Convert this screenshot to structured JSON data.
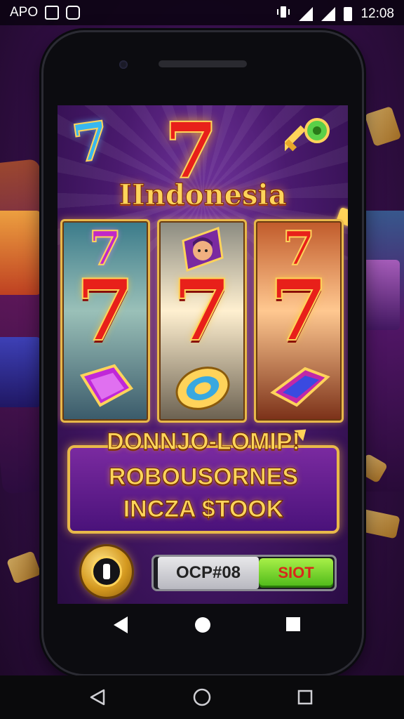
{
  "status_bar": {
    "carrier": "APO",
    "time": "12:08",
    "icons": [
      "notification-square-icon",
      "message-icon",
      "vibrate-icon",
      "no-signal-icon",
      "signal-icon",
      "battery-icon"
    ]
  },
  "game": {
    "title": "IIndonesia",
    "top_symbols": [
      "7",
      "7"
    ],
    "reels": [
      {
        "small_symbol": "7",
        "big_symbol": "7",
        "bottom_icon": "purple-gem-icon"
      },
      {
        "small_symbol": "hero-portrait-icon",
        "big_symbol": "7",
        "bottom_icon": "gold-chip-icon"
      },
      {
        "small_symbol": "7",
        "big_symbol": "7",
        "bottom_icon": "blue-gem-icon"
      }
    ],
    "banner": {
      "line1": "DONNJO-LOMIP!",
      "line2": "ROBOUSORNES",
      "line3": "INCZA $TOOK"
    },
    "code_value": "OCP#08",
    "slot_label": "SIOT"
  },
  "nav": {
    "phone": [
      "back-icon",
      "home-icon",
      "recents-icon"
    ],
    "system": [
      "back-icon",
      "home-icon",
      "recents-icon"
    ]
  },
  "colors": {
    "accent_gold": "#ffd45a",
    "seven_red": "#e8201a",
    "banner_purple": "#7a2aa0",
    "slot_green": "#4cb818"
  }
}
